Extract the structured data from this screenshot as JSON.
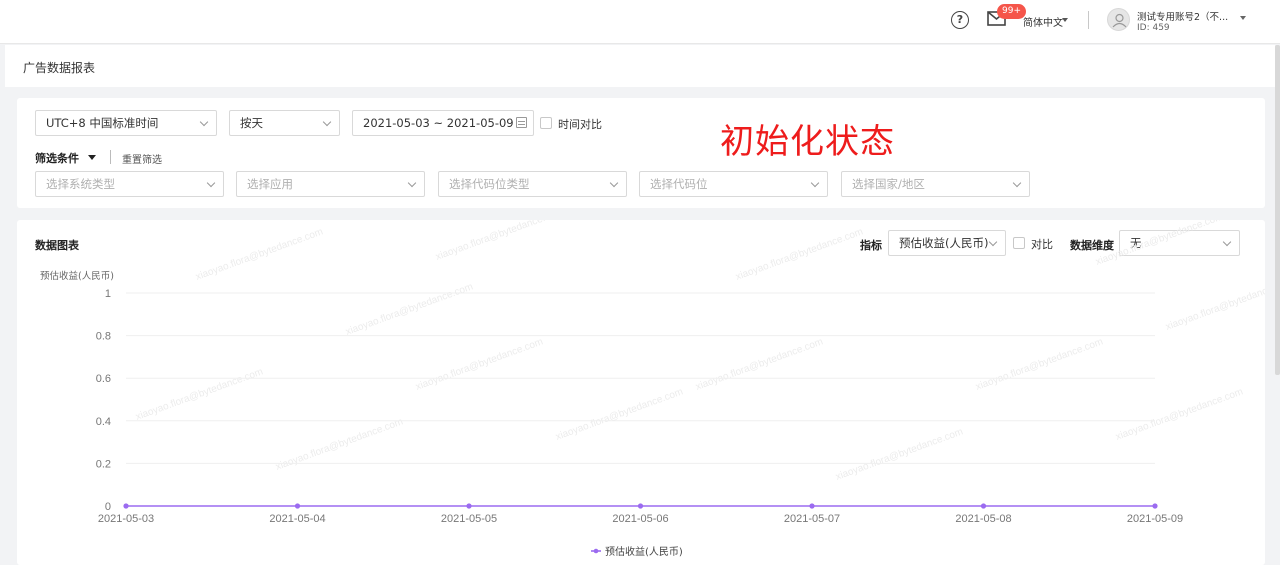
{
  "header": {
    "help_icon": "question-circle-icon",
    "mail_icon": "mail-icon",
    "mail_badge": "99+",
    "language": "简体中文",
    "user_name": "测试专用账号2（不...",
    "user_id": "ID: 459"
  },
  "page": {
    "title": "广告数据报表"
  },
  "filters": {
    "timezone": "UTC+8 中国标准时间",
    "granularity": "按天",
    "date_range": "2021-05-03 ~ 2021-05-09",
    "time_compare_label": "时间对比",
    "filter_toggle": "筛选条件",
    "reset_label": "重置筛选",
    "placeholders": [
      "选择系统类型",
      "选择应用",
      "选择代码位类型",
      "选择代码位",
      "选择国家/地区"
    ]
  },
  "overlay_note": "初始化状态",
  "chart_panel": {
    "title": "数据图表",
    "metric_label": "指标",
    "metric_value": "预估收益(人民币)",
    "compare_label": "对比",
    "dimension_label": "数据维度",
    "dimension_value": "无"
  },
  "chart_data": {
    "type": "line",
    "title": "",
    "ylabel": "预估收益(人民币)",
    "xlabel": "",
    "categories": [
      "2021-05-03",
      "2021-05-04",
      "2021-05-05",
      "2021-05-06",
      "2021-05-07",
      "2021-05-08",
      "2021-05-09"
    ],
    "ylim": [
      0,
      1
    ],
    "yticks": [
      "0",
      "0.2",
      "0.4",
      "0.6",
      "0.8",
      "1"
    ],
    "grid": true,
    "legend_position": "bottom",
    "series": [
      {
        "name": "预估收益(人民币)",
        "color": "#9b6bf0",
        "values": [
          0,
          0,
          0,
          0,
          0,
          0,
          0
        ]
      }
    ]
  },
  "watermark": "xiaoyao.flora@bytedance.com",
  "colors": {
    "accent": "#9b6bf0",
    "badge": "#f5554a",
    "overlay": "#ee1c1c"
  }
}
